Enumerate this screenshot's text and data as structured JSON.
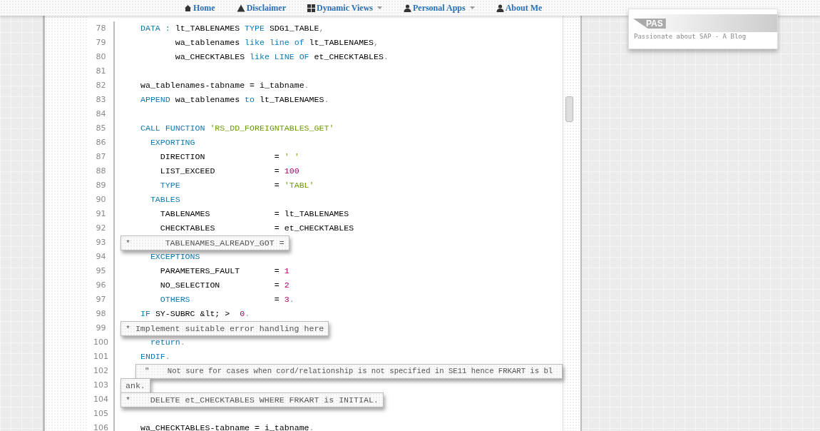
{
  "nav": [
    {
      "kind": "house",
      "label": "Home",
      "caret": false
    },
    {
      "kind": "warning",
      "label": "Disclaimer",
      "caret": false
    },
    {
      "kind": "grid",
      "label": "Dynamic Views",
      "caret": true
    },
    {
      "kind": "person",
      "label": "Personal Apps",
      "caret": true
    },
    {
      "kind": "person",
      "label": "About Me",
      "caret": false
    }
  ],
  "logo": {
    "mark": "PAS",
    "tagline": "Passionate about SAP - A Blog"
  },
  "code_lines": [
    {
      "number": "78",
      "kind": "code",
      "tokens": [
        {
          "kind": "kw",
          "text": "DATA : "
        },
        {
          "kind": "plain",
          "text": "lt_TABLENAMES "
        },
        {
          "kind": "kw",
          "text": "TYPE "
        },
        {
          "kind": "plain",
          "text": "SDG1_TABLE"
        },
        {
          "kind": "punct",
          "text": ","
        }
      ]
    },
    {
      "number": "79",
      "kind": "code",
      "tokens": [
        {
          "kind": "plain",
          "text": "       wa_tablenames "
        },
        {
          "kind": "kw",
          "text": "like line of "
        },
        {
          "kind": "plain",
          "text": "lt_TABLENAMES"
        },
        {
          "kind": "punct",
          "text": ","
        }
      ]
    },
    {
      "number": "80",
      "kind": "code",
      "tokens": [
        {
          "kind": "plain",
          "text": "       wa_CHECKTABLES "
        },
        {
          "kind": "kw",
          "text": "like LINE OF "
        },
        {
          "kind": "plain",
          "text": "et_CHECKTABLES"
        },
        {
          "kind": "punct",
          "text": "."
        }
      ]
    },
    {
      "number": "81",
      "kind": "code"
    },
    {
      "number": "82",
      "kind": "code",
      "tokens": [
        {
          "kind": "plain",
          "text": "wa_tablenames-tabname = i_tabname"
        },
        {
          "kind": "punct",
          "text": "."
        }
      ]
    },
    {
      "number": "83",
      "kind": "code",
      "tokens": [
        {
          "kind": "kw",
          "text": "APPEND "
        },
        {
          "kind": "plain",
          "text": "wa_tablenames "
        },
        {
          "kind": "kw",
          "text": "to "
        },
        {
          "kind": "plain",
          "text": "lt_TABLENAMES"
        },
        {
          "kind": "punct",
          "text": "."
        }
      ]
    },
    {
      "number": "84",
      "kind": "code"
    },
    {
      "number": "85",
      "kind": "code",
      "tokens": [
        {
          "kind": "kw",
          "text": "CALL FUNCTION "
        },
        {
          "kind": "str",
          "text": "'RS_DD_FOREIGNTABLES_GET'"
        }
      ]
    },
    {
      "number": "86",
      "kind": "code",
      "tokens": [
        {
          "kind": "kw",
          "text": "  EXPORTING"
        }
      ]
    },
    {
      "number": "87",
      "kind": "code",
      "tokens": [
        {
          "kind": "plain",
          "text": "    DIRECTION              = "
        },
        {
          "kind": "str",
          "text": "' '"
        }
      ]
    },
    {
      "number": "88",
      "kind": "code",
      "tokens": [
        {
          "kind": "plain",
          "text": "    LIST_EXCEED            = "
        },
        {
          "kind": "num",
          "text": "100"
        }
      ]
    },
    {
      "number": "89",
      "kind": "code",
      "tokens": [
        {
          "kind": "kw",
          "text": "    TYPE                   "
        },
        {
          "kind": "plain",
          "text": "= "
        },
        {
          "kind": "str",
          "text": "'TABL'"
        }
      ]
    },
    {
      "number": "90",
      "kind": "code",
      "tokens": [
        {
          "kind": "kw",
          "text": "  TABLES"
        }
      ]
    },
    {
      "number": "91",
      "kind": "code",
      "tokens": [
        {
          "kind": "plain",
          "text": "    TABLENAMES             = lt_TABLENAMES"
        }
      ]
    },
    {
      "number": "92",
      "kind": "code",
      "tokens": [
        {
          "kind": "plain",
          "text": "    CHECKTABLES            = et_CHECKTABLES"
        }
      ]
    },
    {
      "number": "93",
      "kind": "comment",
      "text": "*       TABLENAMES_ALREADY_GOT ="
    },
    {
      "number": "94",
      "kind": "code",
      "tokens": [
        {
          "kind": "kw",
          "text": "  EXCEPTIONS"
        }
      ]
    },
    {
      "number": "95",
      "kind": "code",
      "tokens": [
        {
          "kind": "plain",
          "text": "    PARAMETERS_FAULT       = "
        },
        {
          "kind": "num",
          "text": "1"
        }
      ]
    },
    {
      "number": "96",
      "kind": "code",
      "tokens": [
        {
          "kind": "plain",
          "text": "    NO_SELECTION           = "
        },
        {
          "kind": "num",
          "text": "2"
        }
      ]
    },
    {
      "number": "97",
      "kind": "code",
      "tokens": [
        {
          "kind": "kw",
          "text": "    OTHERS                 "
        },
        {
          "kind": "plain",
          "text": "= "
        },
        {
          "kind": "num",
          "text": "3"
        },
        {
          "kind": "punct",
          "text": "."
        }
      ]
    },
    {
      "number": "98",
      "kind": "code",
      "tokens": [
        {
          "kind": "kw",
          "text": "IF "
        },
        {
          "kind": "plain",
          "text": "SY-SUBRC &lt; >  "
        },
        {
          "kind": "num",
          "text": "0"
        },
        {
          "kind": "punct",
          "text": "."
        }
      ]
    },
    {
      "number": "99",
      "kind": "comment",
      "text": "* Implement suitable error handling here"
    },
    {
      "number": "100",
      "kind": "code",
      "tokens": [
        {
          "kind": "kw",
          "text": "  return"
        },
        {
          "kind": "punct",
          "text": "."
        }
      ]
    },
    {
      "number": "101",
      "kind": "code",
      "tokens": [
        {
          "kind": "kw",
          "text": "ENDIF"
        },
        {
          "kind": "punct",
          "text": "."
        }
      ]
    },
    {
      "number": "102",
      "kind": "comment_wide",
      "text": "\"    Not sure for cases when cord/relationship is not specified in SE11 hence FRKART is bl"
    },
    {
      "number": "103",
      "kind": "comment",
      "text": "ank."
    },
    {
      "number": "104",
      "kind": "comment",
      "text": "*    DELETE et_CHECKTABLES WHERE FRKART is INITIAL."
    },
    {
      "number": "105",
      "kind": "code"
    },
    {
      "number": "106",
      "kind": "code",
      "tokens": [
        {
          "kind": "plain",
          "text": "wa_CHECKTABLES-tabname = i_tabname"
        },
        {
          "kind": "punct",
          "text": "."
        }
      ]
    }
  ]
}
